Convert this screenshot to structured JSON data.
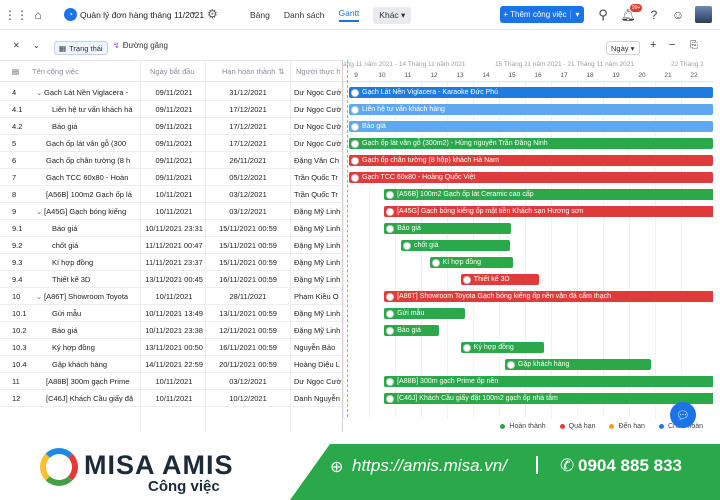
{
  "header": {
    "project_title": "Quản lý đơn hàng tháng 11/2021",
    "views": [
      "Bảng",
      "Danh sách",
      "Gantt"
    ],
    "more_label": "Khác",
    "add_label": "+ Thêm công việc",
    "notif_count": "99+"
  },
  "toolbar": {
    "status_label": "Trạng thái",
    "line_label": "Đường găng",
    "zoom_label": "Ngày"
  },
  "table": {
    "columns": [
      "Tên công việc",
      "Ngày bắt đầu",
      "Hạn hoàn thành",
      "Người thực h"
    ],
    "rows": [
      {
        "id": "4",
        "name": "Gạch Lát Nền Viglacera -",
        "start": "09/11/2021",
        "due": "31/12/2021",
        "owner": "Dư Ngọc Cườ",
        "indent": 0,
        "caret": true
      },
      {
        "id": "4.1",
        "name": "Liên hệ tư vấn khách hà",
        "start": "09/11/2021",
        "due": "17/12/2021",
        "owner": "Dư Ngọc Cườ",
        "indent": 1,
        "caret": false
      },
      {
        "id": "4.2",
        "name": "Báo giá",
        "start": "09/11/2021",
        "due": "17/12/2021",
        "owner": "Dư Ngọc Cườ",
        "indent": 1,
        "caret": false
      },
      {
        "id": "5",
        "name": "Gạch ốp lát vân gỗ (300",
        "start": "09/11/2021",
        "due": "17/12/2021",
        "owner": "Dư Ngọc Cườ",
        "indent": 0,
        "caret": false
      },
      {
        "id": "6",
        "name": "Gạch ốp chân tường (8 h",
        "start": "09/11/2021",
        "due": "26/11/2021",
        "owner": "Đặng Văn Ch",
        "indent": 0,
        "caret": false
      },
      {
        "id": "7",
        "name": "Gạch TCC 60x80 - Hoàn",
        "start": "09/11/2021",
        "due": "05/12/2021",
        "owner": "Trần Quốc Tr",
        "indent": 0,
        "caret": false
      },
      {
        "id": "8",
        "name": "[A56B] 100m2 Gạch ốp lá",
        "start": "10/11/2021",
        "due": "03/12/2021",
        "owner": "Trần Quốc Tr",
        "indent": 0,
        "caret": false
      },
      {
        "id": "9",
        "name": "[A45G] Gạch bóng kiếng",
        "start": "10/11/2021",
        "due": "03/12/2021",
        "owner": "Đặng Mỹ Linh",
        "indent": 0,
        "caret": true
      },
      {
        "id": "9.1",
        "name": "Báo giá",
        "start": "10/11/2021 23:31",
        "due": "15/11/2021 00:59",
        "owner": "Đặng Mỹ Linh",
        "indent": 1,
        "caret": false
      },
      {
        "id": "9.2",
        "name": "chốt giá",
        "start": "11/11/2021 00:47",
        "due": "15/11/2021 00:59",
        "owner": "Đặng Mỹ Linh",
        "indent": 1,
        "caret": false
      },
      {
        "id": "9.3",
        "name": "Kí hợp đồng",
        "start": "11/11/2021 23:37",
        "due": "15/11/2021 00:59",
        "owner": "Đặng Mỹ Linh",
        "indent": 1,
        "caret": false
      },
      {
        "id": "9.4",
        "name": "Thiết kế 3D",
        "start": "13/11/2021 00:45",
        "due": "16/11/2021 00:59",
        "owner": "Đặng Mỹ Linh",
        "indent": 1,
        "caret": false
      },
      {
        "id": "10",
        "name": "[A86T] Showroom Toyota",
        "start": "10/11/2021",
        "due": "28/11/2021",
        "owner": "Phạm Kiều O",
        "indent": 0,
        "caret": true
      },
      {
        "id": "10.1",
        "name": "Gửi mẫu",
        "start": "10/11/2021 13:49",
        "due": "13/11/2021 00:59",
        "owner": "Đặng Mỹ Linh",
        "indent": 1,
        "caret": false
      },
      {
        "id": "10.2",
        "name": "Báo giá",
        "start": "10/11/2021 23:38",
        "due": "12/11/2021 00:59",
        "owner": "Đặng Mỹ Linh",
        "indent": 1,
        "caret": false
      },
      {
        "id": "10.3",
        "name": "Ký hợp đồng",
        "start": "13/11/2021 00:50",
        "due": "16/11/2021 00:59",
        "owner": "Nguyễn Bảo",
        "indent": 1,
        "caret": false
      },
      {
        "id": "10.4",
        "name": "Gặp khách hàng",
        "start": "14/11/2021 22:59",
        "due": "20/11/2021 00:59",
        "owner": "Hoàng Diệu L",
        "indent": 1,
        "caret": false
      },
      {
        "id": "11",
        "name": "[A88B] 300m gạch Prime",
        "start": "10/11/2021",
        "due": "03/12/2021",
        "owner": "Dư Ngọc Cườ",
        "indent": 0,
        "caret": false
      },
      {
        "id": "12",
        "name": "[C46J] Khách Cầu giấy đặ",
        "start": "10/11/2021",
        "due": "10/12/2021",
        "owner": "Danh Nguyễn",
        "indent": 0,
        "caret": false
      }
    ]
  },
  "gantt": {
    "week_label_1": "áng 11 năm 2021 - 14 Tháng 11 năm 2021",
    "week_label_2": "15 Tháng 11 năm 2021 - 21 Tháng 11 năm 2021",
    "week_label_3": "22 Tháng 1",
    "days": [
      "9",
      "10",
      "11",
      "12",
      "13",
      "14",
      "15",
      "16",
      "17",
      "18",
      "19",
      "20",
      "21",
      "22"
    ],
    "bars": [
      {
        "label": "Gạch Lát Nền Viglacera - Karaoke Đức Phú",
        "start": 0,
        "len": 14,
        "color": "#1e7be0"
      },
      {
        "label": "Liên hệ tư vấn khách hàng",
        "start": 0,
        "len": 14,
        "color": "#5ea8f0"
      },
      {
        "label": "Báo giá",
        "start": 0,
        "len": 14,
        "color": "#5ea8f0"
      },
      {
        "label": "Gạch ốp lát vân gỗ (300m2) - Hùng nguyên Trần Đăng Ninh",
        "start": 0,
        "len": 14,
        "color": "#2aa84a"
      },
      {
        "label": "Gạch ốp chân tường (8 hộp) khách Hà Nam",
        "start": 0,
        "len": 14,
        "color": "#e03b3b"
      },
      {
        "label": "Gạch TCC 60x80 - Hoàng Quốc Việt",
        "start": 0,
        "len": 14,
        "color": "#e03b3b"
      },
      {
        "label": "[A56B] 100m2 Gạch ốp lát Ceramic cao cấp",
        "start": 1.35,
        "len": 13,
        "color": "#2aa84a"
      },
      {
        "label": "[A45G] Gạch bóng kiếng ốp mặt tiền Khách sạn Hương sơn",
        "start": 1.35,
        "len": 13,
        "color": "#e03b3b"
      },
      {
        "label": "Báo giá",
        "start": 1.35,
        "len": 4.9,
        "color": "#2aa84a"
      },
      {
        "label": "chốt giá",
        "start": 2.0,
        "len": 4.2,
        "color": "#2aa84a"
      },
      {
        "label": "Kí hợp đồng",
        "start": 3.1,
        "len": 3.2,
        "color": "#2aa84a"
      },
      {
        "label": "Thiết kế 3D",
        "start": 4.3,
        "len": 3.0,
        "color": "#e03b3b"
      },
      {
        "label": "[A86T] Showroom Toyota Gạch bóng kiếng ốp nền vân đá cẩm thạch",
        "start": 1.35,
        "len": 13,
        "color": "#e03b3b"
      },
      {
        "label": "Gửi mẫu",
        "start": 1.35,
        "len": 3.1,
        "color": "#2aa84a"
      },
      {
        "label": "Báo giá",
        "start": 1.35,
        "len": 2.1,
        "color": "#2aa84a"
      },
      {
        "label": "Ký hợp đồng",
        "start": 4.3,
        "len": 3.2,
        "color": "#2aa84a"
      },
      {
        "label": "Gặp khách hàng",
        "start": 6.0,
        "len": 5.6,
        "color": "#2aa84a"
      },
      {
        "label": "[A88B] 300m gạch Prime ốp nền",
        "start": 1.35,
        "len": 13,
        "color": "#2aa84a"
      },
      {
        "label": "[C46J] Khách Cầu giấy đặt 100m2 gạch ốp nhà tắm",
        "start": 1.35,
        "len": 13,
        "color": "#2aa84a"
      }
    ]
  },
  "legend": [
    {
      "label": "Hoàn thành",
      "color": "#2aa84a"
    },
    {
      "label": "Quá hạn",
      "color": "#e03b3b"
    },
    {
      "label": "Đến hạn",
      "color": "#f0a020"
    },
    {
      "label": "Chưa hoàn",
      "color": "#1e7be0"
    }
  ],
  "footer": {
    "brand": "MISA AMIS",
    "brand_sub": "Công việc",
    "url": "https://amis.misa.vn/",
    "phone": "0904 885 833"
  }
}
